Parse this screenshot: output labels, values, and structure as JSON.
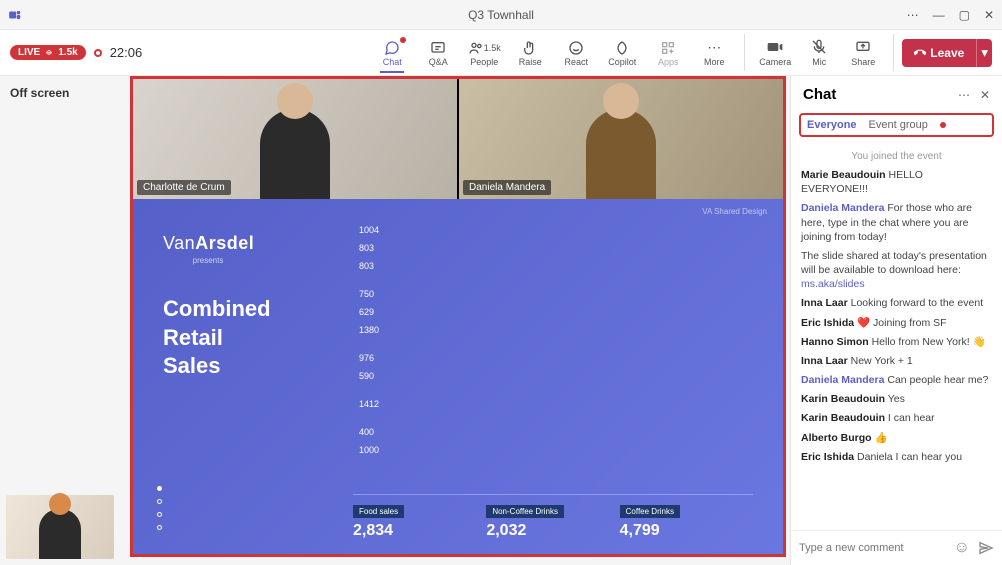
{
  "window": {
    "title": "Q3 Townhall"
  },
  "toolbar": {
    "live": "LIVE",
    "viewers": "1.5k",
    "time": "22:06",
    "chat": "Chat",
    "qa": "Q&A",
    "people_count": "1.5k",
    "people": "People",
    "raise": "Raise",
    "react": "React",
    "copilot": "Copilot",
    "apps": "Apps",
    "more": "More",
    "camera": "Camera",
    "mic": "Mic",
    "share": "Share",
    "leave": "Leave"
  },
  "left": {
    "offscreen": "Off screen"
  },
  "participants": [
    {
      "name": "Charlotte de Crum"
    },
    {
      "name": "Daniela Mandera"
    }
  ],
  "slide": {
    "brand_pre": "Van",
    "brand_bold": "Arsdel",
    "presents": "presents",
    "headline1": "Combined",
    "headline2": "Retail",
    "headline3": "Sales",
    "corner": "VA Shared Design",
    "totals": [
      {
        "label": "Food sales",
        "value": "2,834"
      },
      {
        "label": "Non-Coffee Drinks",
        "value": "2,032"
      },
      {
        "label": "Coffee Drinks",
        "value": "4,799"
      }
    ]
  },
  "chart_data": {
    "type": "bar",
    "orientation": "horizontal",
    "series": [
      {
        "name": "Food sales",
        "color": "#1e3a6e",
        "values": [
          1004,
          750,
          976,
          400,
          1000
        ]
      },
      {
        "name": "Non-Coffee Drinks",
        "color": "#2e63b8",
        "values": [
          803,
          629,
          590,
          1412,
          0
        ]
      },
      {
        "name": "Coffee Drinks",
        "color": "#4aa3e8",
        "values": [
          803,
          1380,
          0,
          0,
          0
        ]
      }
    ],
    "visible_labels": [
      1004,
      803,
      803,
      750,
      629,
      1380,
      976,
      590,
      1412,
      400,
      1000
    ],
    "xlim": [
      0,
      1500
    ]
  },
  "chat": {
    "title": "Chat",
    "tab_everyone": "Everyone",
    "tab_event": "Event group",
    "joined": "You joined the event",
    "messages": [
      {
        "sender": "Marie Beaudouin",
        "text": "HELLO EVERYONE!!!"
      },
      {
        "sender": "Daniela Mandera",
        "link": true,
        "text": "For those who are here, type in the chat where you are joining from today!"
      },
      {
        "sender": "",
        "text": "The slide shared at today's presentation will be available to download here: ",
        "url": "ms.aka/slides"
      },
      {
        "sender": "Inna Laar",
        "text": "Looking forward to the event"
      },
      {
        "sender": "Eric Ishida",
        "text": "❤️  Joining from SF"
      },
      {
        "sender": "Hanno Simon",
        "text": "Hello from New York!  👋"
      },
      {
        "sender": "Inna Laar",
        "text": "New York + 1"
      },
      {
        "sender": "Daniela Mandera",
        "link": true,
        "text": "Can people hear me?"
      },
      {
        "sender": "Karin Beaudouin",
        "text": "Yes"
      },
      {
        "sender": "Karin Beaudouin",
        "text": "I can hear"
      },
      {
        "sender": "Alberto Burgo",
        "text": "👍"
      },
      {
        "sender": "Eric Ishida",
        "text": "Daniela I can hear you"
      }
    ],
    "placeholder": "Type a new comment"
  }
}
